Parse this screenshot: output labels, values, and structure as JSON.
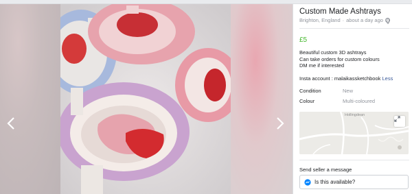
{
  "listing": {
    "title": "Custom Made Ashtrays",
    "location": "Brighton, England",
    "separator": "·",
    "posted": "about a day ago",
    "price": "£5",
    "description_lines": [
      "Beautiful custom 3D ashtrays",
      "Can take orders for custom colours",
      "DM me if interested"
    ],
    "insta_text": "Insta account : malaikassketchbook",
    "less_link": "Less",
    "details": [
      {
        "label": "Condition",
        "value": "New"
      },
      {
        "label": "Colour",
        "value": "Multi-coloured"
      }
    ],
    "map_place_label": "Hollingdean"
  },
  "contact": {
    "heading": "Send seller a message",
    "message_text": "Is this available?"
  },
  "colors": {
    "price": "#42b72a",
    "link": "#385898",
    "muted": "#90949c",
    "messenger": "#0084ff"
  },
  "icons": [
    "chevron-left-icon",
    "chevron-right-icon",
    "globe-icon",
    "expand-icon",
    "messenger-icon"
  ]
}
